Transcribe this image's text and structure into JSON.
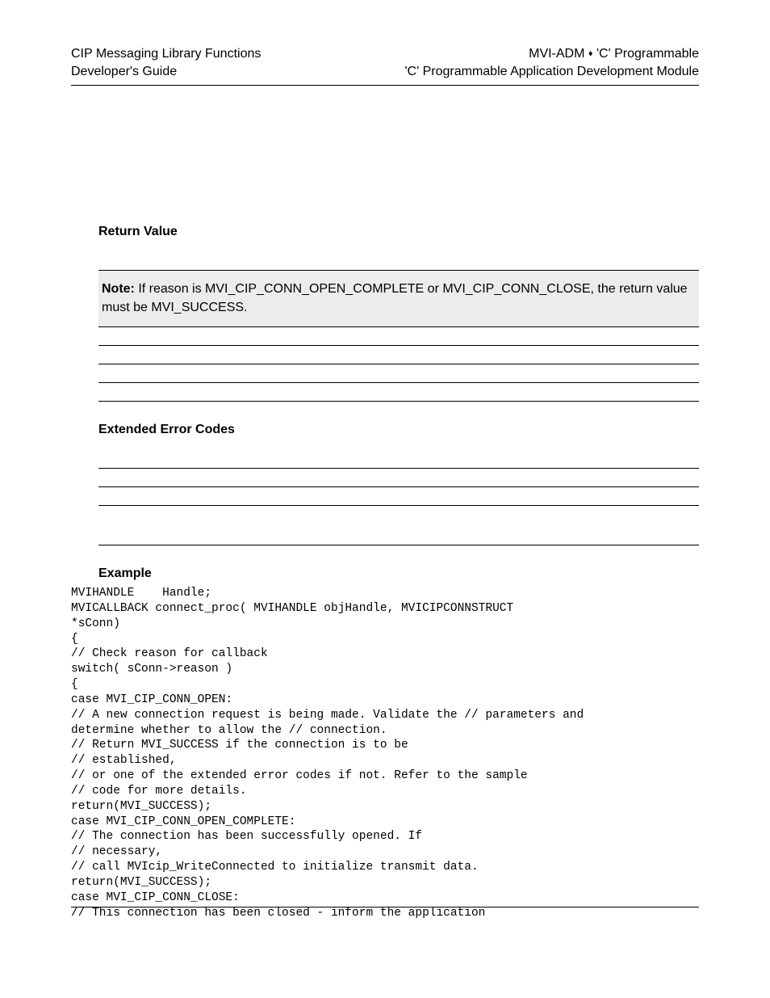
{
  "header": {
    "left_line1": "CIP Messaging Library Functions",
    "left_line2": "Developer's Guide",
    "right_line1_pre": "MVI-ADM ",
    "right_line1_post": " 'C' Programmable",
    "right_line2": "'C' Programmable Application Development Module"
  },
  "sections": {
    "return_value_heading": "Return Value",
    "note_label": "Note:",
    "note_text": " If reason is MVI_CIP_CONN_OPEN_COMPLETE or MVI_CIP_CONN_CLOSE, the return value must be MVI_SUCCESS.",
    "extended_heading": "Extended Error Codes",
    "example_heading": "Example"
  },
  "code": "MVIHANDLE    Handle;\nMVICALLBACK connect_proc( MVIHANDLE objHandle, MVICIPCONNSTRUCT\n*sConn)\n{\n// Check reason for callback\nswitch( sConn->reason )\n{\ncase MVI_CIP_CONN_OPEN:\n// A new connection request is being made. Validate the // parameters and\ndetermine whether to allow the // connection.\n// Return MVI_SUCCESS if the connection is to be\n// established,\n// or one of the extended error codes if not. Refer to the sample\n// code for more details.\nreturn(MVI_SUCCESS);\ncase MVI_CIP_CONN_OPEN_COMPLETE:\n// The connection has been successfully opened. If\n// necessary,\n// call MVIcip_WriteConnected to initialize transmit data.\nreturn(MVI_SUCCESS);\ncase MVI_CIP_CONN_CLOSE:\n// This connection has been closed - inform the application"
}
